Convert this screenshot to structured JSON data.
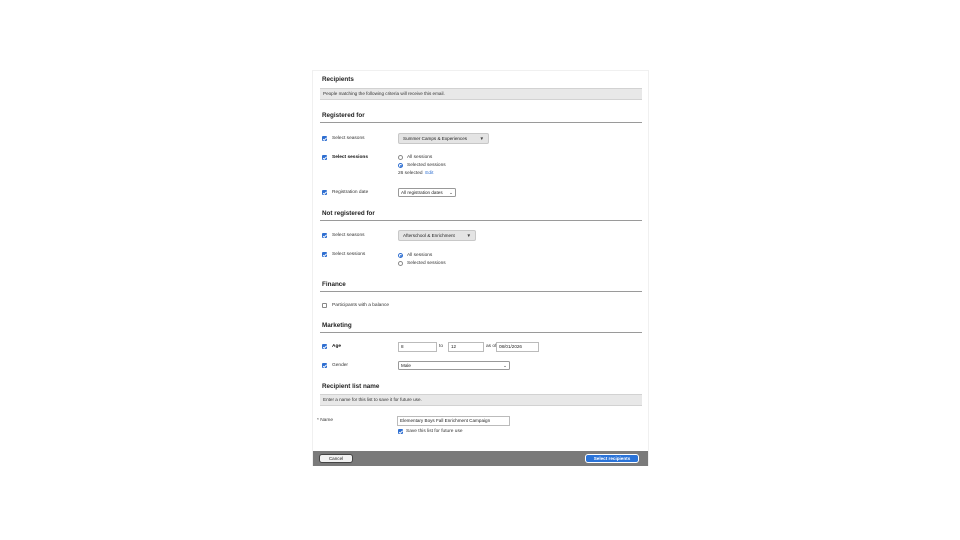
{
  "recipients": {
    "title": "Recipients",
    "description": "People matching the following criteria will receive this email."
  },
  "registered_for": {
    "title": "Registered for",
    "select_seasons_label": "Select seasons",
    "season_value": "Summer Camps & Experiences",
    "select_sessions_label": "Select sessions",
    "radio_all": "All sessions",
    "radio_selected": "Selected sessions",
    "selected_count": "26 selected",
    "edit_link": "Edit",
    "registration_date_label": "Registration date",
    "registration_date_value": "All registration dates"
  },
  "not_registered_for": {
    "title": "Not registered for",
    "select_seasons_label": "Select seasons",
    "season_value": "Afterschool & Enrichment",
    "select_sessions_label": "Select sessions",
    "radio_all": "All sessions",
    "radio_selected": "Selected sessions"
  },
  "finance": {
    "title": "Finance",
    "balance_label": "Participants with a balance"
  },
  "marketing": {
    "title": "Marketing",
    "age_label": "Age",
    "age_from": "8",
    "age_to_label": "to",
    "age_to": "12",
    "as_of_label": "as of",
    "as_of_date": "08/01/2026",
    "gender_label": "Gender",
    "gender_value": "Male"
  },
  "recipient_list": {
    "title": "Recipient list name",
    "description": "Enter a name for this list to save it for future use.",
    "required_mark": "*",
    "name_label": "Name",
    "name_value": "Elementary Boys Fall Enrichment Campaign",
    "save_label": "Save this list for future use"
  },
  "footer": {
    "cancel_label": "Cancel",
    "select_label": "Select recipients"
  },
  "colors": {
    "accent": "#2f6fd1",
    "footer_bg": "#7a7a7a",
    "strip_bg": "#e8e8e8"
  }
}
